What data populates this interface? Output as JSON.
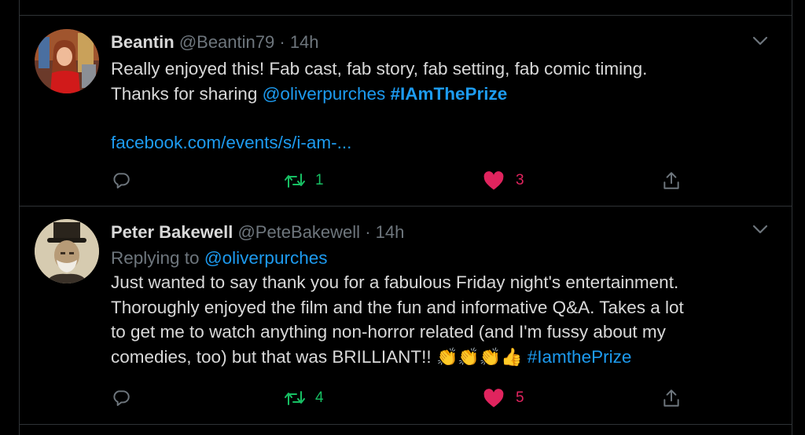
{
  "tweets": [
    {
      "name": "Beantin",
      "handle": "@Beantin79",
      "dot": "·",
      "time": "14h",
      "line1": "Really enjoyed this! Fab cast, fab story, fab setting, fab comic timing.",
      "line2_text": "Thanks for sharing ",
      "line2_mention": "@oliverpurches",
      "line2_space": " ",
      "line2_tag": "#IAmThePrize",
      "link": "facebook.com/events/s/i-am-...",
      "retweets": "1",
      "likes": "3"
    },
    {
      "name": "Peter Bakewell",
      "handle": "@PeteBakewell",
      "dot": "·",
      "time": "14h",
      "replying_label": "Replying to ",
      "replying_to": "@oliverpurches",
      "lines": [
        "Just wanted to say thank you for a fabulous Friday night's entertainment.",
        "Thoroughly enjoyed the film and the fun and informative Q&A. Takes a lot",
        "to get me to watch anything non-horror related (and I'm fussy about my"
      ],
      "last_line_text": "comedies, too) but that was BRILLIANT!! ",
      "last_line_emoji": "👏👏👏👍",
      "last_line_space": " ",
      "last_line_tag": "#IamthePrize",
      "retweets": "4",
      "likes": "5"
    }
  ],
  "colors": {
    "background": "#000000",
    "link": "#1d9bf0",
    "retweet": "#17bf63",
    "like": "#e0245e",
    "muted": "#6e767d",
    "border": "#2f3336"
  },
  "icons": [
    "reply-icon",
    "retweet-icon",
    "heart-icon",
    "share-icon",
    "caret-down-icon"
  ]
}
